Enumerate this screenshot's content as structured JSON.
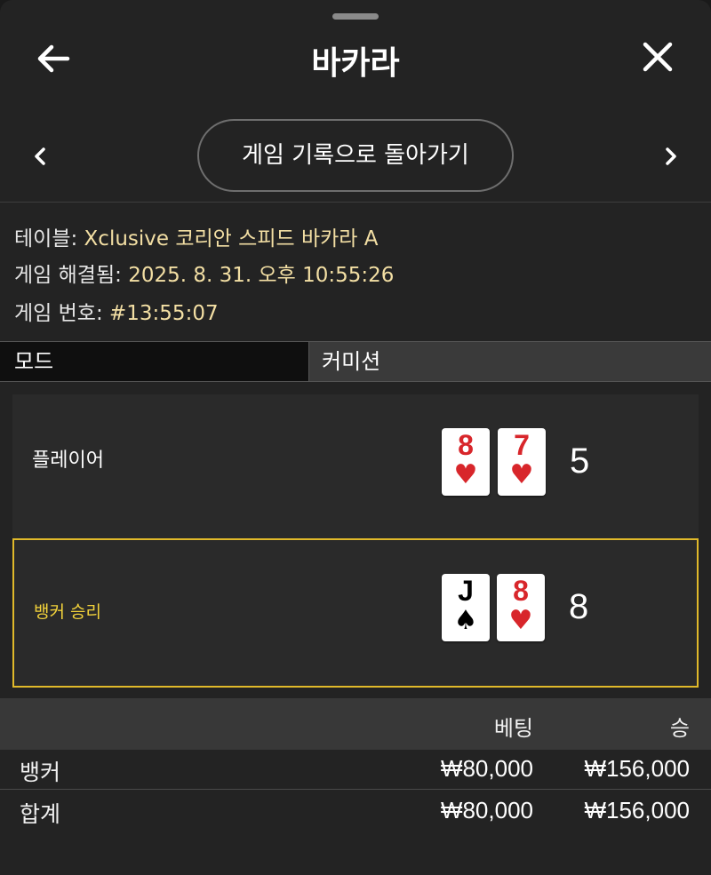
{
  "header": {
    "title": "바카라",
    "back_icon": "arrow-left-icon",
    "close_icon": "close-icon"
  },
  "nav": {
    "history_button": "게임 기록으로 돌아가기",
    "prev_icon": "chevron-left-icon",
    "next_icon": "chevron-right-icon"
  },
  "info": {
    "table_label": "테이블:",
    "table_value": "Xclusive 코리안 스피드 바카라 A",
    "resolved_label": "게임 해결됨:",
    "resolved_value": "2025. 8. 31. 오후 10:55:26",
    "number_label": "게임 번호:",
    "number_value": "#13:55:07"
  },
  "mode": {
    "label": "모드",
    "value": "커미션"
  },
  "player": {
    "label": "플레이어",
    "cards": [
      {
        "rank": "8",
        "suit": "♥",
        "color": "#d8262b"
      },
      {
        "rank": "7",
        "suit": "♥",
        "color": "#d8262b"
      }
    ],
    "score": "5"
  },
  "banker": {
    "label": "뱅커 승리",
    "cards": [
      {
        "rank": "J",
        "suit": "♠",
        "color": "#000000"
      },
      {
        "rank": "8",
        "suit": "♥",
        "color": "#d8262b"
      }
    ],
    "score": "8"
  },
  "bets": {
    "col_bet": "베팅",
    "col_win": "승",
    "rows": [
      {
        "label": "뱅커",
        "bet": "₩80,000",
        "win": "₩156,000"
      },
      {
        "label": "합계",
        "bet": "₩80,000",
        "win": "₩156,000"
      }
    ]
  },
  "colors": {
    "accent_gold": "#e0b92a",
    "value_text": "#f3dfa4",
    "heart_red": "#d8262b"
  }
}
